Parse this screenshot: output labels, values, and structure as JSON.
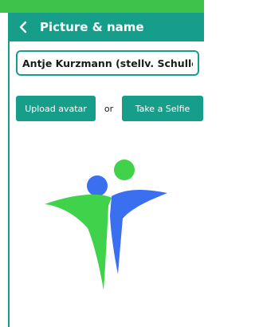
{
  "header": {
    "title": "Picture & name",
    "back_icon": "chevron-left-icon"
  },
  "name_field": {
    "value": "Antje Kurzmann (stellv. Schulleiterin)"
  },
  "actions": {
    "upload_label": "Upload avatar",
    "separator": "or",
    "selfie_label": "Take a Selfie"
  },
  "avatar": {
    "icon": "people-logo-icon"
  },
  "colors": {
    "header_teal": "#179e8a",
    "top_strip_green": "#3ec24c",
    "logo_green": "#3fd24a",
    "logo_blue": "#3a6ff0"
  }
}
